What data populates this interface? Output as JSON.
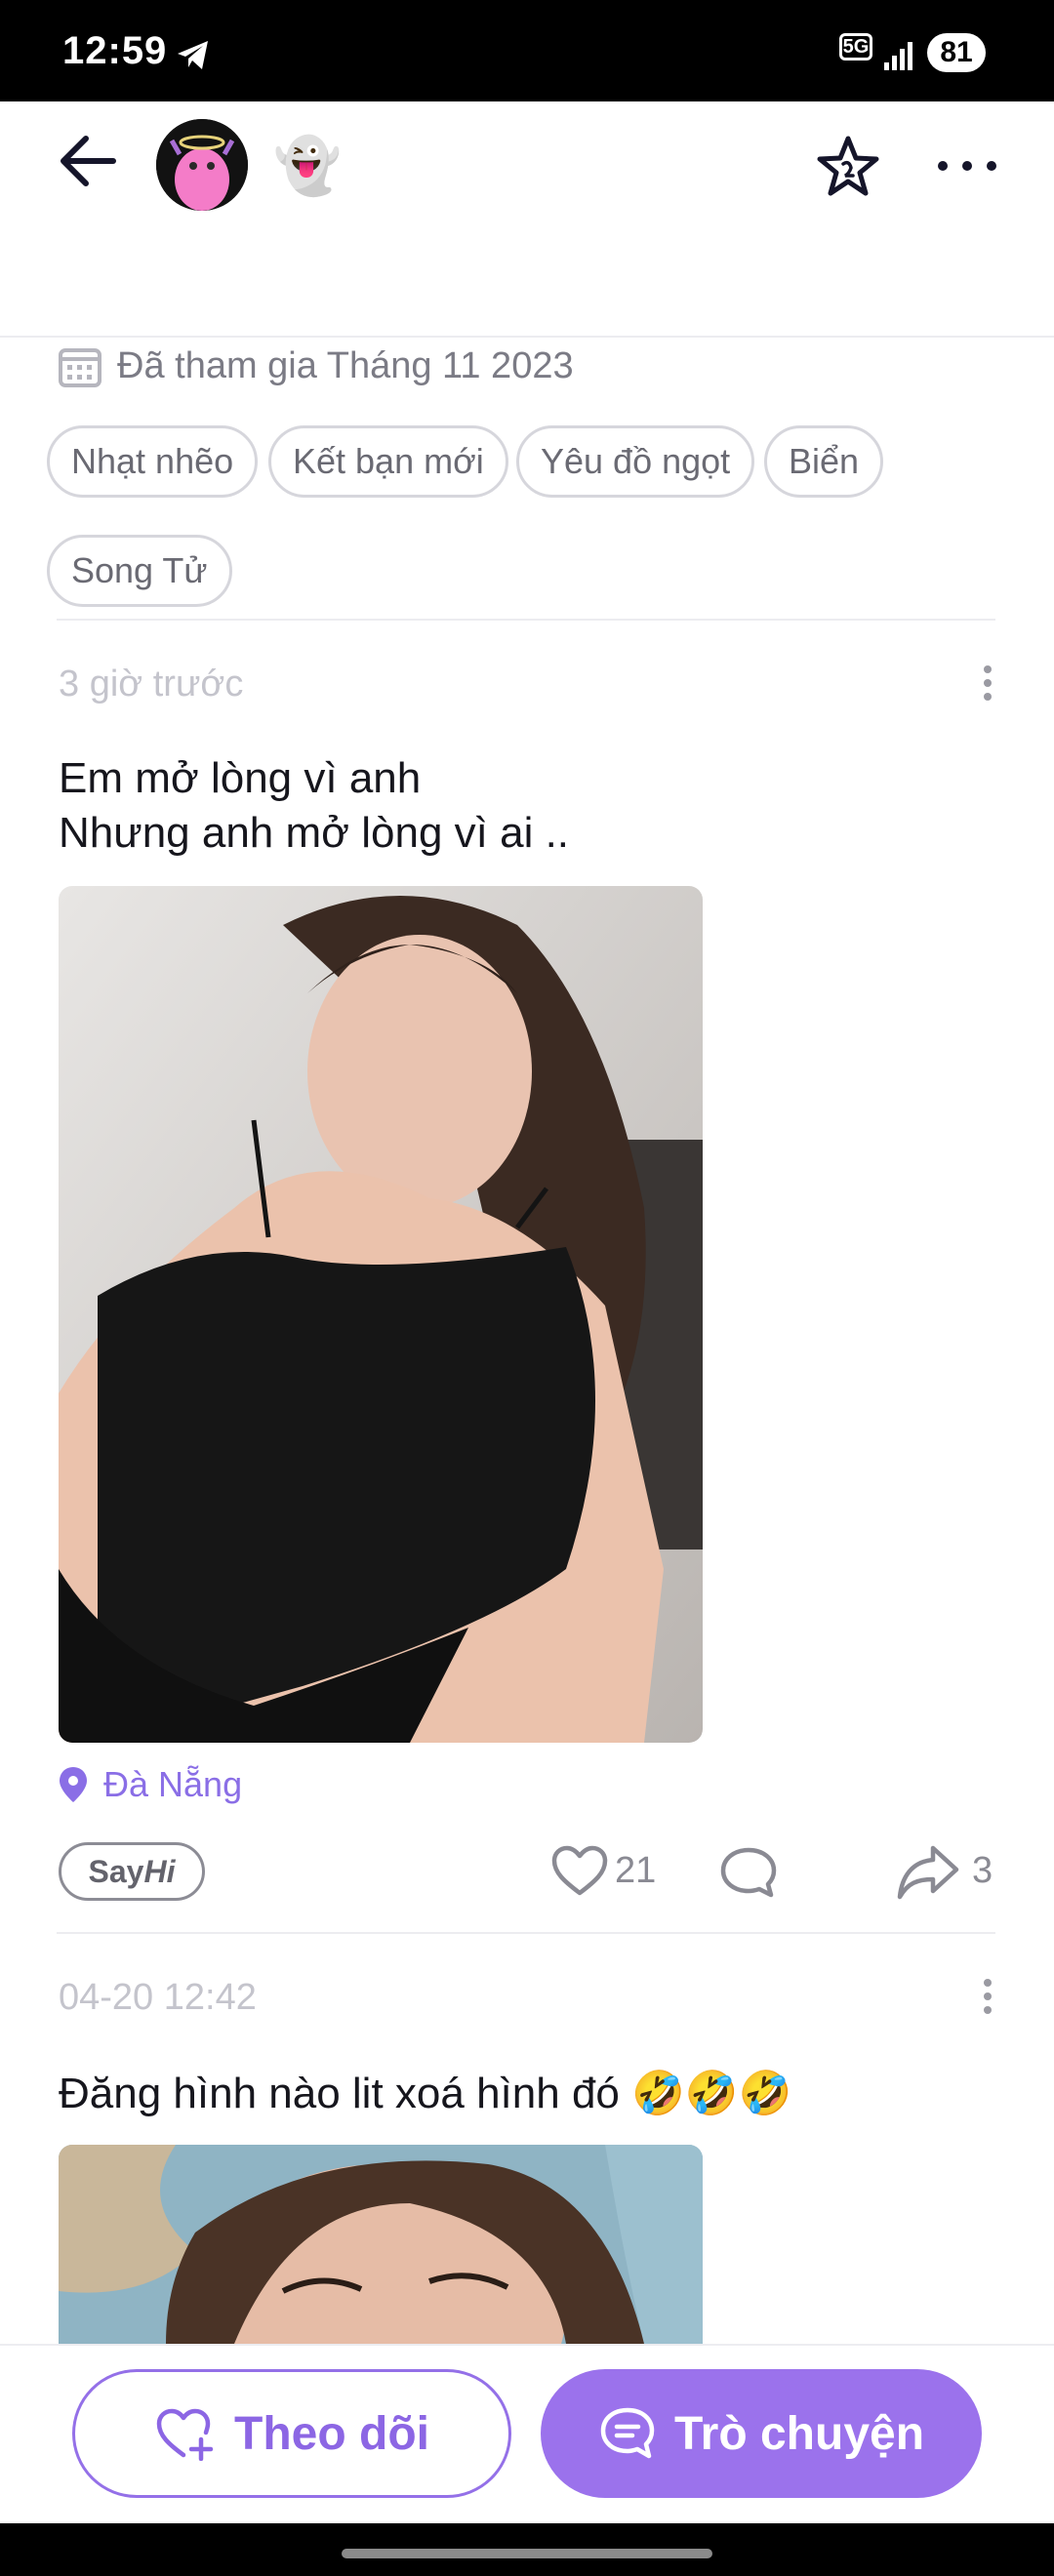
{
  "status_bar": {
    "time": "12:59",
    "network": "5G",
    "battery": "81"
  },
  "header": {
    "avatar_icon": "pink-monster-avatar",
    "badge_emoji": "👻"
  },
  "profile": {
    "joined_text": "Đã tham gia Tháng 11 2023",
    "tags": [
      "Nhạt nhẽo",
      "Kết bạn mới",
      "Yêu đồ ngọt",
      "Biển",
      "Song Tử"
    ]
  },
  "posts": [
    {
      "time": "3 giờ trước",
      "text": "Em mở lòng vì anh\nNhưng anh mở lòng vì ai ..",
      "location": "Đà Nẵng",
      "sayhi_a": "Say",
      "sayhi_b": "Hi",
      "likes": "21",
      "shares": "3"
    },
    {
      "time": "04-20 12:42",
      "text": "Đăng hình nào lit xoá hình đó 🤣🤣🤣"
    }
  ],
  "actions": {
    "follow_label": "Theo dõi",
    "chat_label": "Trò chuyện"
  },
  "colors": {
    "accent": "#9b72ec",
    "location": "#8a6ee6"
  }
}
